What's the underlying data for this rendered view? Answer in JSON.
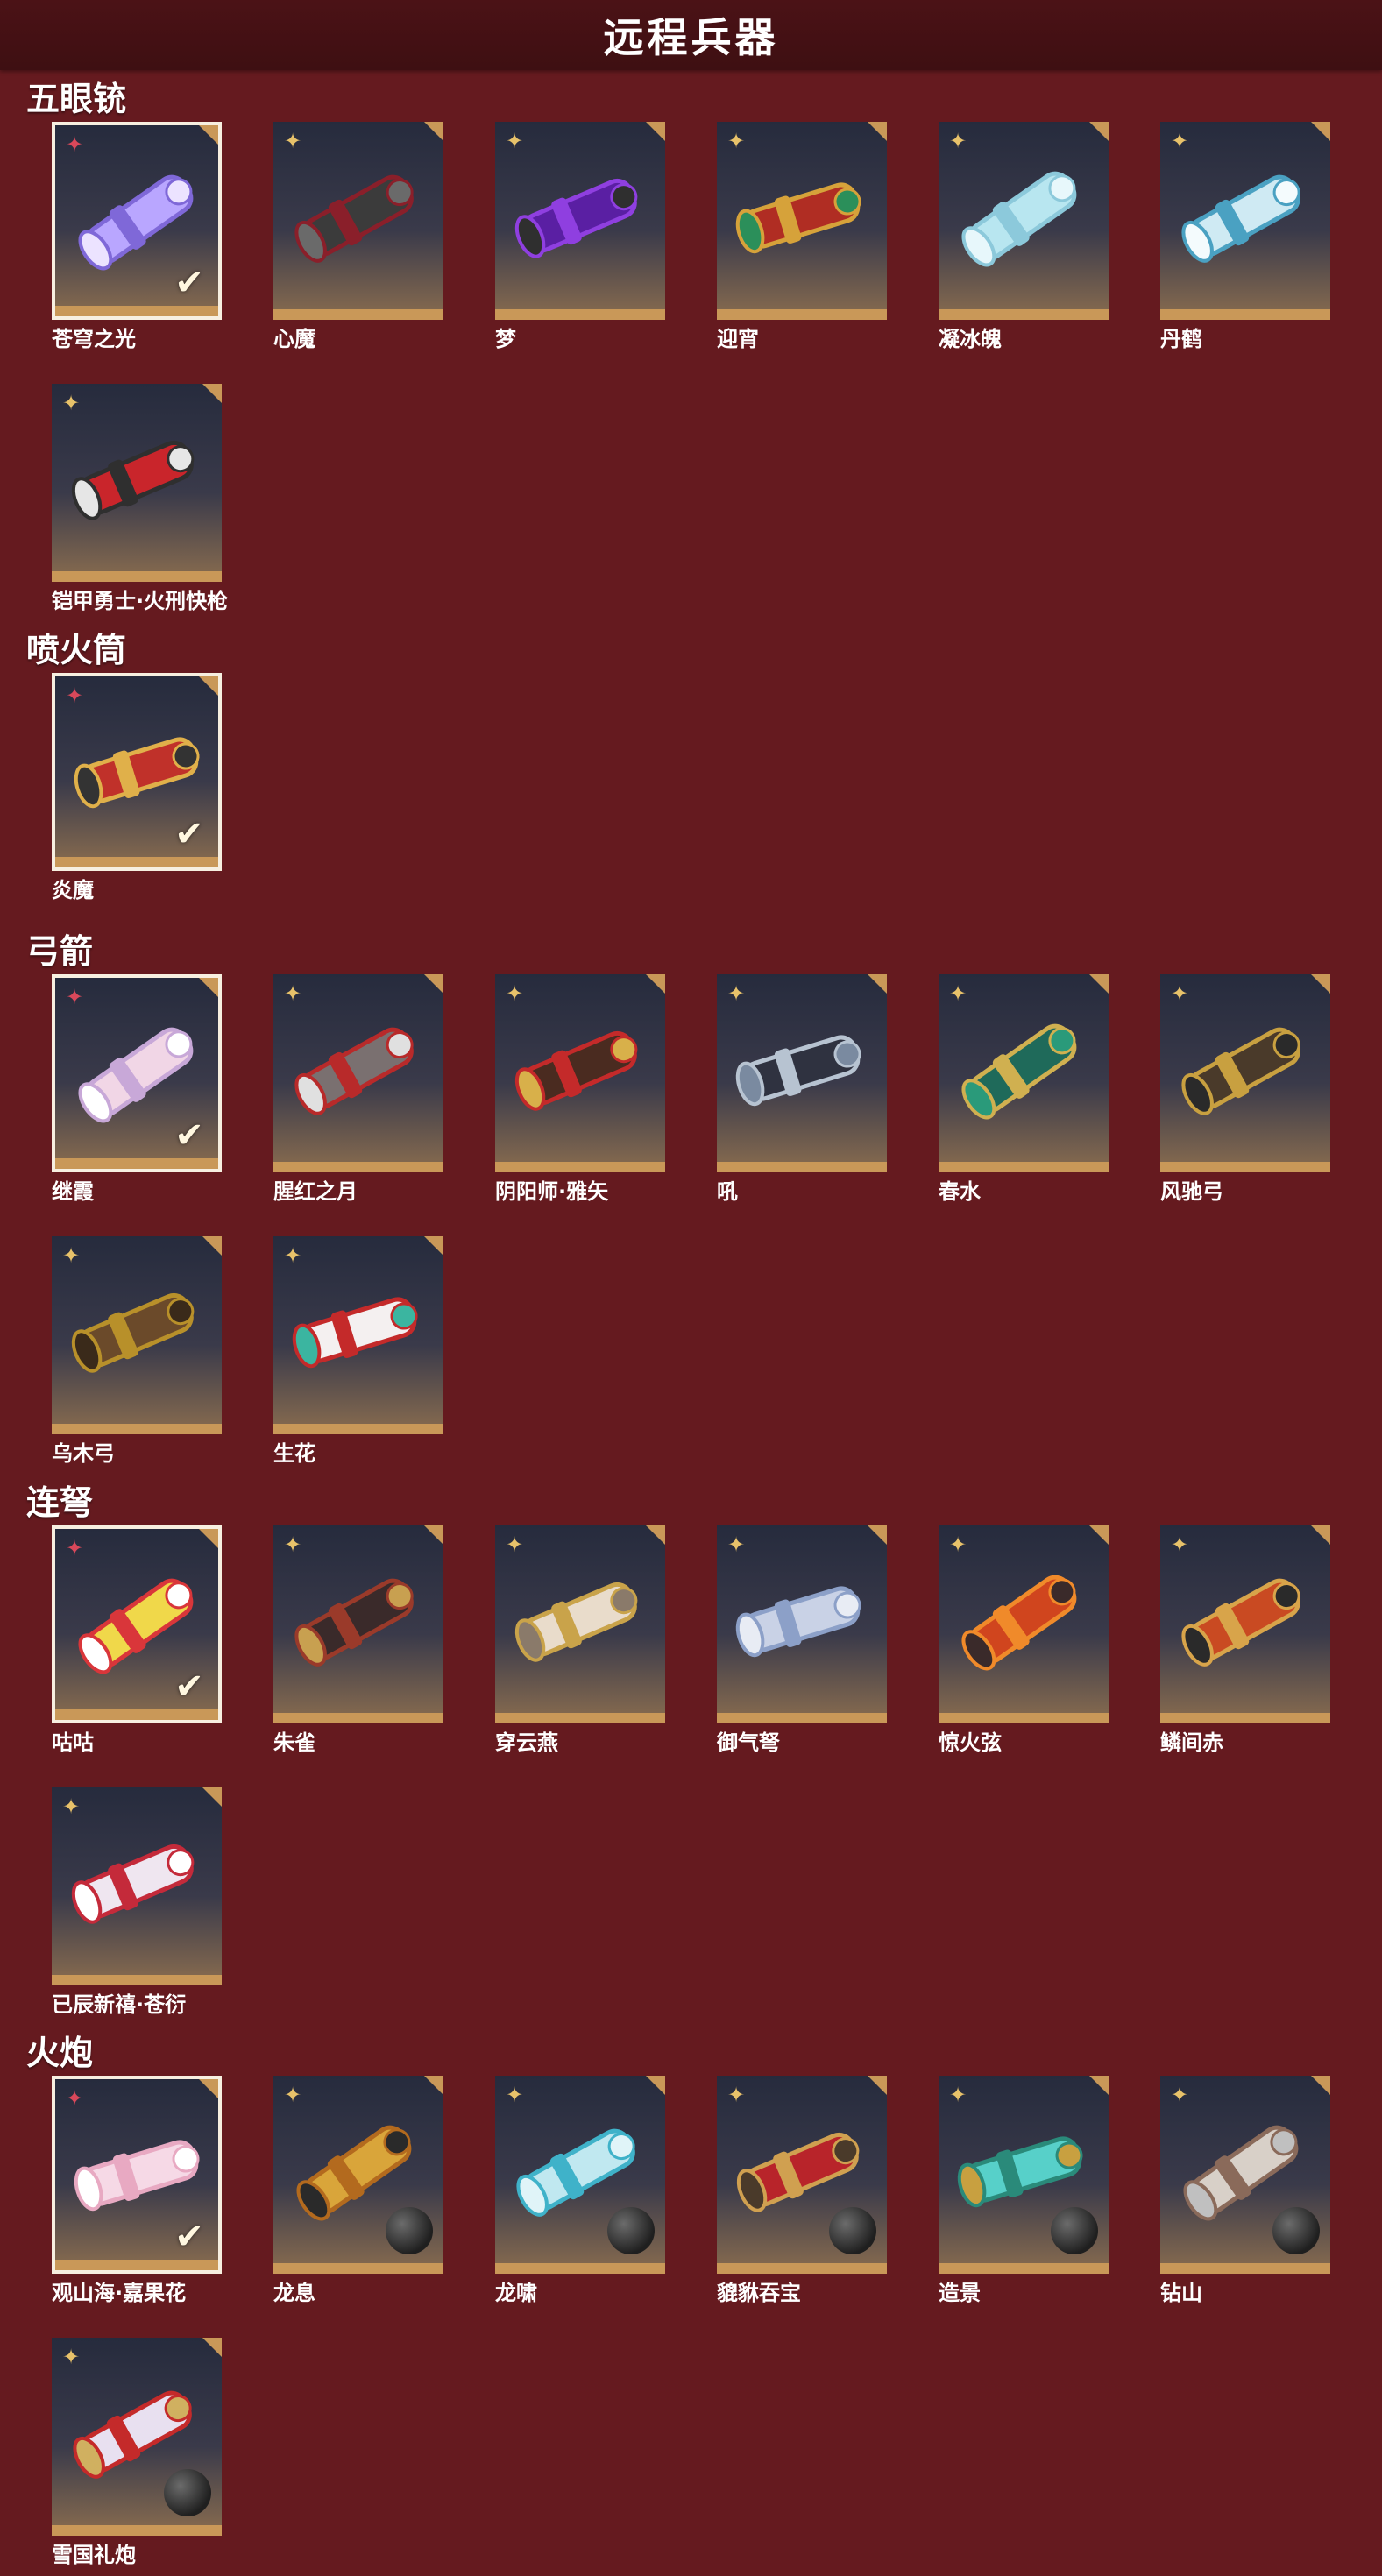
{
  "page": {
    "title": "远程兵器"
  },
  "sections": [
    {
      "title": "五眼铳",
      "items": [
        {
          "name": "苍穹之光",
          "selected": true
        },
        {
          "name": "心魔"
        },
        {
          "name": "梦"
        },
        {
          "name": "迎宵"
        },
        {
          "name": "凝冰魄"
        },
        {
          "name": "丹鹤"
        },
        {
          "name": "铠甲勇士·火刑快枪"
        }
      ]
    },
    {
      "title": "喷火筒",
      "items": [
        {
          "name": "炎魔",
          "selected": true
        }
      ]
    },
    {
      "title": "弓箭",
      "items": [
        {
          "name": "继霞",
          "selected": true
        },
        {
          "name": "腥红之月"
        },
        {
          "name": "阴阳师·雅矢"
        },
        {
          "name": "吼"
        },
        {
          "name": "春水"
        },
        {
          "name": "风驰弓"
        },
        {
          "name": "乌木弓"
        },
        {
          "name": "生花"
        }
      ]
    },
    {
      "title": "连弩",
      "items": [
        {
          "name": "咕咕",
          "selected": true
        },
        {
          "name": "朱雀"
        },
        {
          "name": "穿云燕"
        },
        {
          "name": "御气弩"
        },
        {
          "name": "惊火弦"
        },
        {
          "name": "鳞间赤"
        },
        {
          "name": "已辰新禧·苍衍"
        }
      ]
    },
    {
      "title": "火炮",
      "items": [
        {
          "name": "观山海·嘉果花",
          "selected": true
        },
        {
          "name": "龙息"
        },
        {
          "name": "龙啸"
        },
        {
          "name": "貔貅吞宝"
        },
        {
          "name": "造景"
        },
        {
          "name": "钻山"
        },
        {
          "name": "雪国礼炮"
        }
      ]
    }
  ],
  "icons": {
    "rarity_badge": "four-point-star-icon",
    "selected_mark": "checkmark-icon"
  },
  "colors": {
    "background": "#651a1f",
    "tile_frame": "#c99858",
    "badge": "#e8c26a",
    "selected_badge": "#d9485a"
  }
}
